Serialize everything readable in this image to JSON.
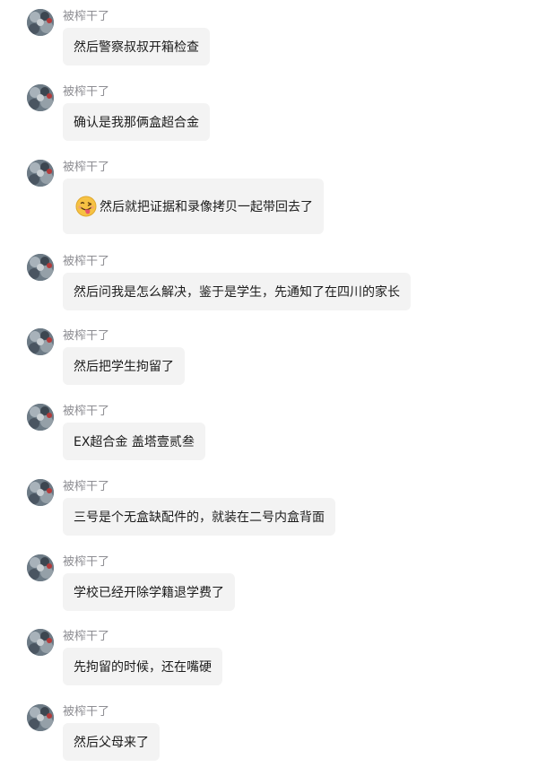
{
  "messages": [
    {
      "sender": "被榨干了",
      "text": "然后警察叔叔开箱检查"
    },
    {
      "sender": "被榨干了",
      "text": "确认是我那俩盒超合金"
    },
    {
      "sender": "被榨干了",
      "text": "然后就把证据和录像拷贝一起带回去了",
      "emoji": "face-with-tongue-emoji"
    },
    {
      "sender": "被榨干了",
      "text": "然后问我是怎么解决，鉴于是学生，先通知了在四川的家长"
    },
    {
      "sender": "被榨干了",
      "text": "然后把学生拘留了"
    },
    {
      "sender": "被榨干了",
      "text": "EX超合金 盖塔壹贰叁"
    },
    {
      "sender": "被榨干了",
      "text": "三号是个无盒缺配件的，就装在二号内盒背面"
    },
    {
      "sender": "被榨干了",
      "text": "学校已经开除学籍退学费了"
    },
    {
      "sender": "被榨干了",
      "text": "先拘留的时候，还在嘴硬"
    },
    {
      "sender": "被榨干了",
      "text": "然后父母来了"
    }
  ],
  "colors": {
    "bubble": "#f3f3f3",
    "sender": "#8e8e93",
    "text": "#1c1c1c",
    "avatar": "#6d7b86"
  }
}
